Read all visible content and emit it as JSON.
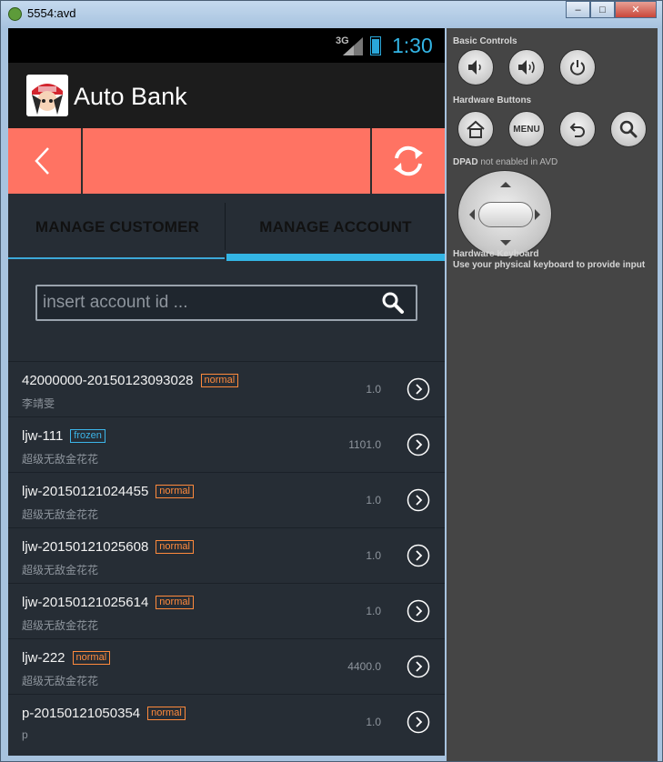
{
  "window": {
    "title": "5554:avd",
    "buttons": [
      "minimize",
      "maximize",
      "close"
    ]
  },
  "statusbar": {
    "network": "3G",
    "time": "1:30"
  },
  "actionbar": {
    "app_name": "Auto Bank"
  },
  "tabs": [
    {
      "label": "MANAGE CUSTOMER",
      "selected": false
    },
    {
      "label": "MANAGE ACCOUNT",
      "selected": true
    }
  ],
  "search": {
    "placeholder": "insert account id ..."
  },
  "accounts": [
    {
      "id": "42000000-20150123093028",
      "status": "normal",
      "owner": "李靖雯",
      "balance": "1.0"
    },
    {
      "id": "ljw-111",
      "status": "frozen",
      "owner": "超级无敌金花花",
      "balance": "1101.0"
    },
    {
      "id": "ljw-20150121024455",
      "status": "normal",
      "owner": "超级无敌金花花",
      "balance": "1.0"
    },
    {
      "id": "ljw-20150121025608",
      "status": "normal",
      "owner": "超级无敌金花花",
      "balance": "1.0"
    },
    {
      "id": "ljw-20150121025614",
      "status": "normal",
      "owner": "超级无敌金花花",
      "balance": "1.0"
    },
    {
      "id": "ljw-222",
      "status": "normal",
      "owner": "超级无敌金花花",
      "balance": "4400.0"
    },
    {
      "id": "p-20150121050354",
      "status": "normal",
      "owner": "p",
      "balance": "1.0"
    }
  ],
  "panel": {
    "basic_controls": "Basic Controls",
    "hardware_buttons": "Hardware Buttons",
    "menu_label": "MENU",
    "dpad_label": "DPAD",
    "dpad_note": "not enabled in AVD",
    "keyboard_title": "Hardware Keyboard",
    "keyboard_note": "Use your physical keyboard to provide input"
  },
  "colors": {
    "toolbar": "#ff7363",
    "accent": "#33b5e5",
    "badge_normal": "#ff8a3c",
    "badge_frozen": "#3cb6ea",
    "background": "#262d35"
  }
}
